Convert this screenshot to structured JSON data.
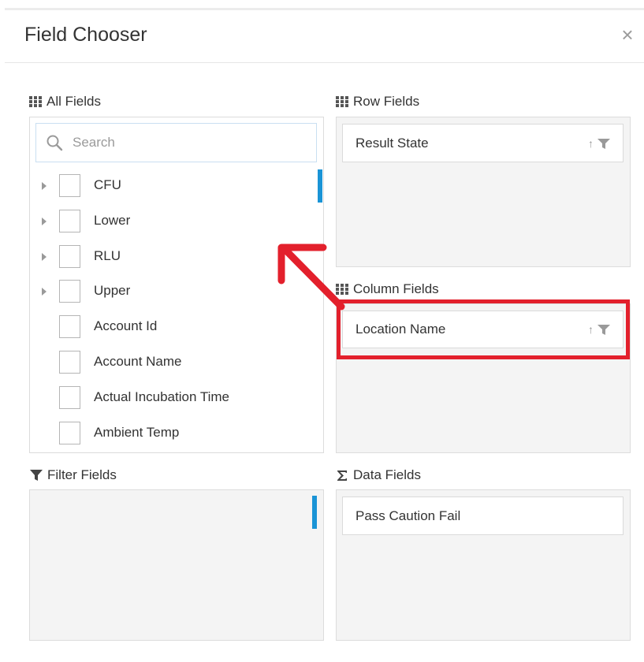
{
  "dialog": {
    "title": "Field Chooser",
    "close_glyph": "×"
  },
  "sections": {
    "all_fields": {
      "label": "All Fields",
      "search_placeholder": "Search",
      "items": [
        {
          "label": "CFU",
          "expandable": true
        },
        {
          "label": "Lower",
          "expandable": true
        },
        {
          "label": "RLU",
          "expandable": true
        },
        {
          "label": "Upper",
          "expandable": true
        },
        {
          "label": "Account Id",
          "expandable": false
        },
        {
          "label": "Account Name",
          "expandable": false
        },
        {
          "label": "Actual Incubation Time",
          "expandable": false
        },
        {
          "label": "Ambient Temp",
          "expandable": false
        }
      ]
    },
    "row_fields": {
      "label": "Row Fields",
      "items": [
        "Result State"
      ]
    },
    "column_fields": {
      "label": "Column Fields",
      "items": [
        "Location Name"
      ]
    },
    "filter_fields": {
      "label": "Filter Fields"
    },
    "data_fields": {
      "label": "Data Fields",
      "items": [
        "Pass Caution Fail"
      ]
    }
  },
  "glyphs": {
    "sort": "↑"
  },
  "icons": [
    "grid-icon",
    "search-icon",
    "funnel-icon",
    "sigma-icon",
    "close-icon",
    "expand-arrow-icon"
  ],
  "colors": {
    "accent": "#1a94d6",
    "annotation": "#e3202c",
    "panel_bg": "#f4f4f4"
  }
}
